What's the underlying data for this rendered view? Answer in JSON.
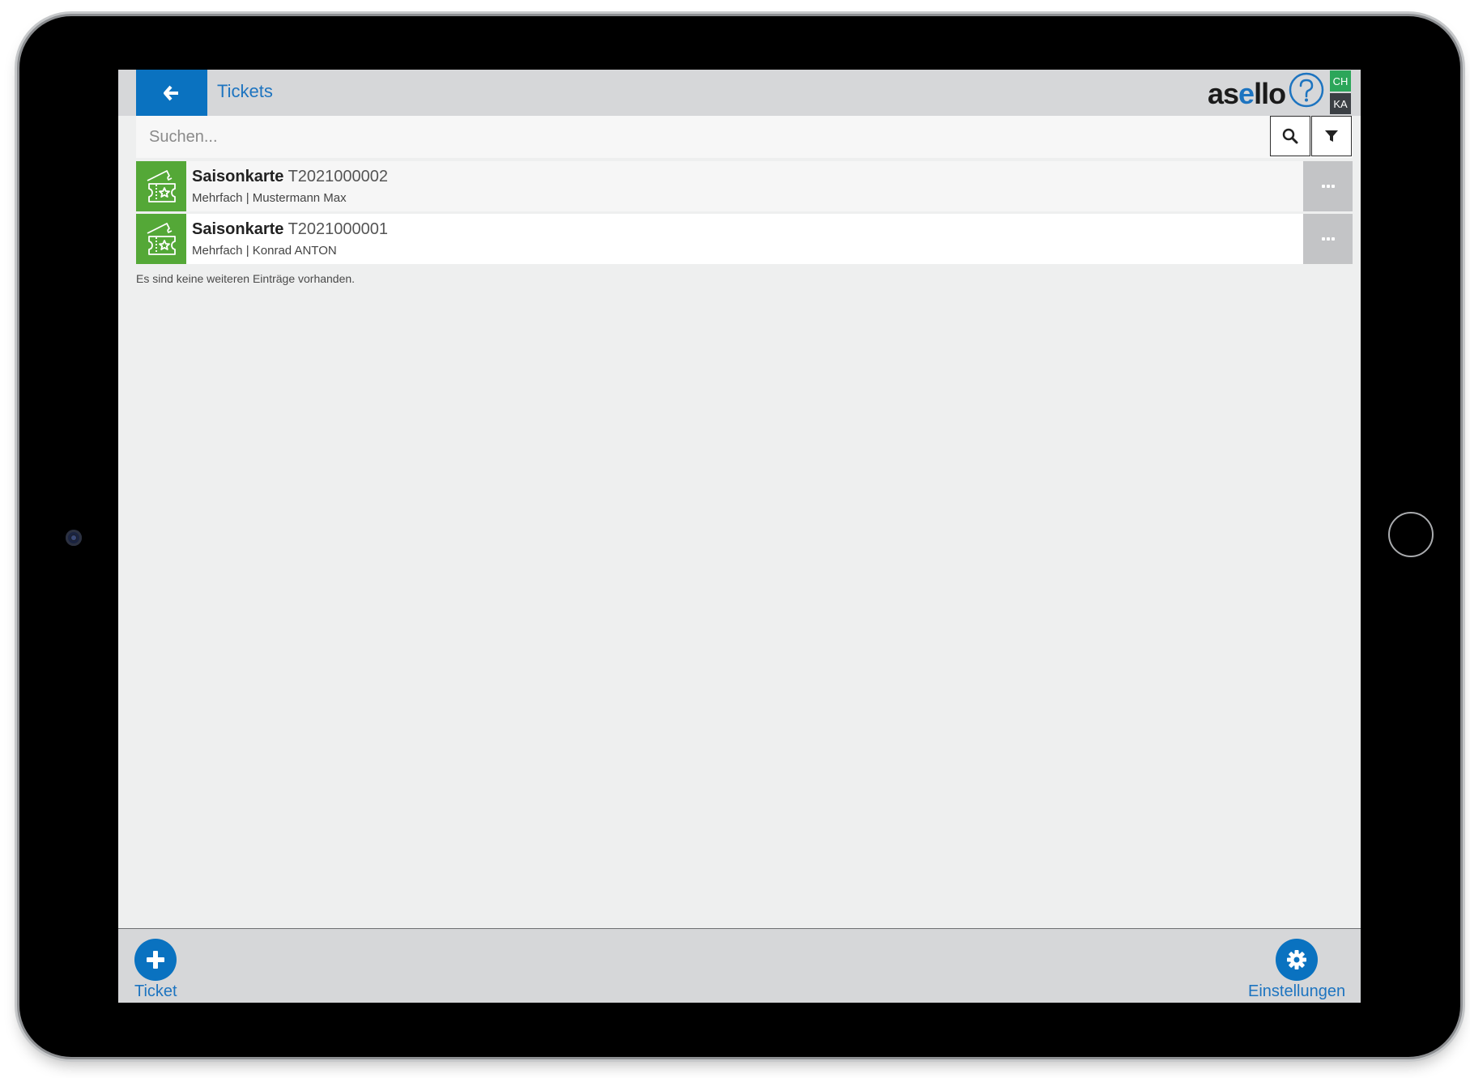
{
  "header": {
    "title": "Tickets",
    "logo_text_a": "as",
    "logo_text_e": "e",
    "logo_text_b": "llo",
    "badges": [
      "CH",
      "KA"
    ],
    "icons": {
      "back": "arrow-left-icon",
      "help": "question-circle-icon"
    }
  },
  "search": {
    "placeholder": "Suchen...",
    "value": "",
    "icons": {
      "search": "magnifier-icon",
      "filter": "funnel-icon"
    }
  },
  "tickets": [
    {
      "type": "Saisonkarte",
      "number": "T2021000002",
      "mode": "Mehrfach",
      "holder": "Mustermann Max",
      "icon": "ticket-star-icon"
    },
    {
      "type": "Saisonkarte",
      "number": "T2021000001",
      "mode": "Mehrfach",
      "holder": "Konrad ANTON",
      "icon": "ticket-star-icon"
    }
  ],
  "list_separator": " | ",
  "empty_note": "Es sind keine weiteren Einträge vorhanden.",
  "footer": {
    "add_label": "Ticket",
    "settings_label": "Einstellungen",
    "icons": {
      "add": "plus-icon",
      "settings": "gear-icon"
    }
  },
  "colors": {
    "accent": "#0a72c0",
    "ticket_green": "#54a837",
    "badge_ch": "#2ca65a",
    "badge_ka": "#3b3f44"
  }
}
